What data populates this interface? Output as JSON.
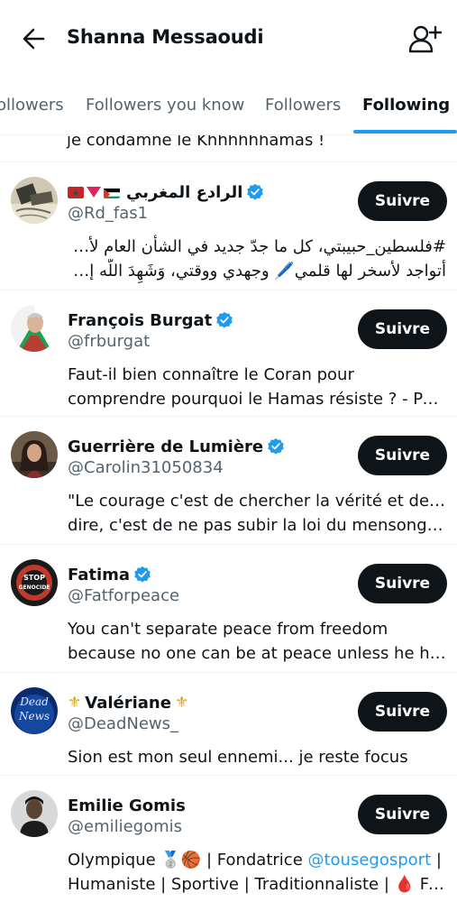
{
  "header": {
    "title": "Shanna Messaoudi"
  },
  "tabs": [
    "ollowers",
    "Followers you know",
    "Followers",
    "Following"
  ],
  "partial_bio": "je condamne le Khhhhhhamas !",
  "users": [
    {
      "name": "الرادع المغربي",
      "handle": "@Rd_fas1",
      "button": "Suivre",
      "bio_lines": [
        "#فلسطين_حبيبتي، كل ما جدّ جديد في الشأن العام لأمتي،",
        "أتواجد لأسخر لها قلمي🖊️ وجهدي ووقتي، وَشَهِدَ اللَّه إن أري..."
      ]
    },
    {
      "name": "François Burgat",
      "handle": "@frburgat",
      "button": "Suivre",
      "bio_lines": [
        "Faut-il bien connaître le Coran pour",
        "comprendre pourquoi le Hamas résiste ? - Po..."
      ]
    },
    {
      "name": "Guerrière de Lumière",
      "handle": "@Carolin31050834",
      "button": "Suivre",
      "bio_lines": [
        "\"Le courage c'est de chercher la vérité et de la",
        "dire, c'est de ne pas subir la loi du mensonge ..."
      ]
    },
    {
      "name": "Fatima",
      "handle": "@Fatforpeace",
      "button": "Suivre",
      "bio_lines": [
        "You can't separate peace from freedom",
        "because no one can be at peace unless he ha..."
      ]
    },
    {
      "name": "Valériane",
      "handle": "@DeadNews_",
      "button": "Suivre",
      "bio_lines": [
        "Sion est mon seul ennemi... je reste focus"
      ]
    },
    {
      "name": "Emilie Gomis",
      "handle": "@emiliegomis",
      "button": "Suivre",
      "bio_lines": [
        "Olympique 🥈🏀 | Fondatrice ",
        "Humaniste | Sportive | Traditionnaliste | 🩸 Fiè..."
      ],
      "bio_mention": "@tousegosport",
      "bio_after_mention": " |"
    }
  ],
  "avatar_texts": {
    "fatima": [
      "STOP",
      "GENOCIDE"
    ],
    "deadnews": [
      "Dead",
      "News"
    ]
  }
}
